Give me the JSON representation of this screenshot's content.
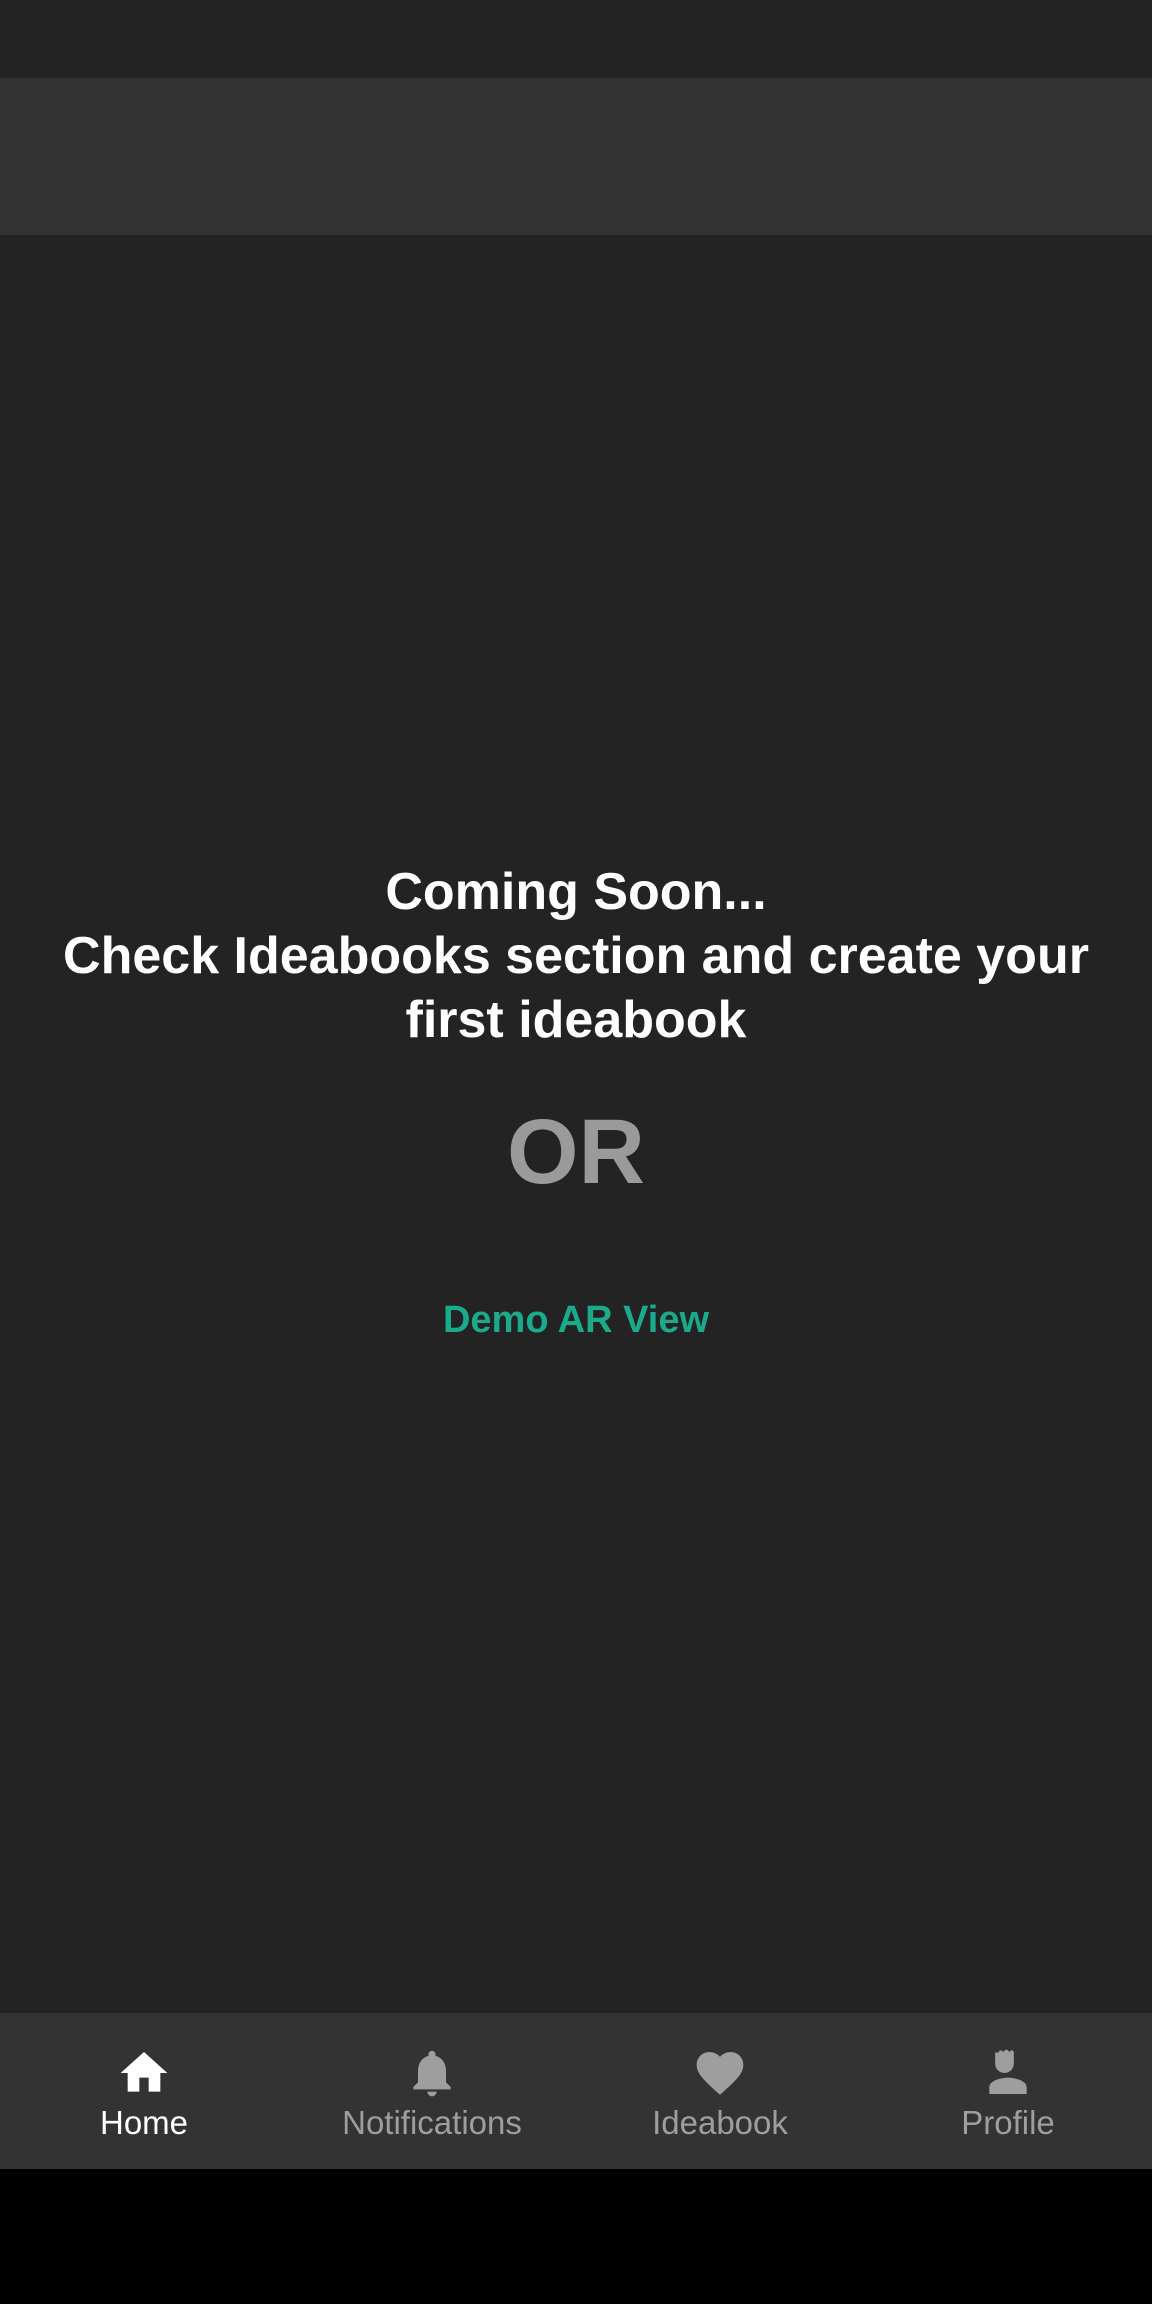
{
  "main": {
    "message_line1": "Coming Soon...",
    "message_line2": "Check Ideabooks section and create your",
    "message_line3": "first ideabook",
    "or_label": "OR",
    "demo_link_label": "Demo AR View"
  },
  "bottom_nav": {
    "items": [
      {
        "label": "Home",
        "icon": "home-icon",
        "active": true
      },
      {
        "label": "Notifications",
        "icon": "bell-icon",
        "active": false
      },
      {
        "label": "Ideabook",
        "icon": "heart-icon",
        "active": false
      },
      {
        "label": "Profile",
        "icon": "person-icon",
        "active": false
      }
    ]
  },
  "colors": {
    "background": "#232323",
    "bar_background": "#333333",
    "accent": "#1aaa8c",
    "inactive": "#9e9e9e",
    "active": "#ffffff"
  }
}
